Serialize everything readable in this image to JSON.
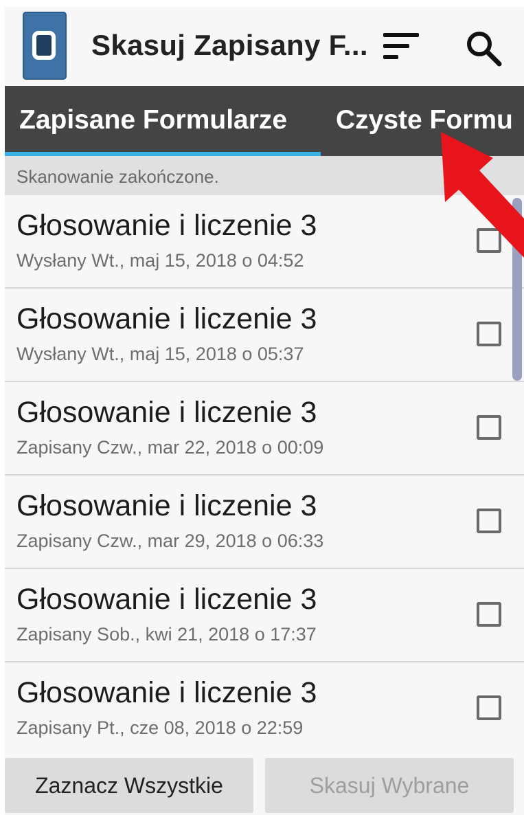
{
  "app": {
    "title": "Skasuj Zapisany F...",
    "icon": "phone-app-icon",
    "actions": [
      {
        "name": "sort",
        "icon": "sort-icon"
      },
      {
        "name": "search",
        "icon": "search-icon"
      }
    ]
  },
  "tabs": [
    {
      "label": "Zapisane Formularze",
      "active": true
    },
    {
      "label": "Czyste Formu",
      "active": false
    }
  ],
  "status": {
    "text": "Skanowanie zakończone."
  },
  "forms": [
    {
      "title": "Głosowanie i liczenie 3",
      "subtitle": "Wysłany Wt., maj 15, 2018 o 04:52",
      "checked": false
    },
    {
      "title": "Głosowanie i liczenie 3",
      "subtitle": "Wysłany Wt., maj 15, 2018 o 05:37",
      "checked": false
    },
    {
      "title": "Głosowanie i liczenie 3",
      "subtitle": "Zapisany Czw., mar 22, 2018 o 00:09",
      "checked": false
    },
    {
      "title": "Głosowanie i liczenie 3",
      "subtitle": "Zapisany Czw., mar 29, 2018 o 06:33",
      "checked": false
    },
    {
      "title": "Głosowanie i liczenie 3",
      "subtitle": "Zapisany Sob., kwi 21, 2018 o 17:37",
      "checked": false
    },
    {
      "title": "Głosowanie i liczenie 3",
      "subtitle": "Zapisany Pt., cze 08, 2018 o 22:59",
      "checked": false
    }
  ],
  "buttons": {
    "select_all": "Zaznacz Wszystkie",
    "delete_selected": "Skasuj Wybrane"
  },
  "colors": {
    "tab_bar": "#444444",
    "tab_indicator": "#34b1e6",
    "annotation_arrow": "#e8141b"
  }
}
